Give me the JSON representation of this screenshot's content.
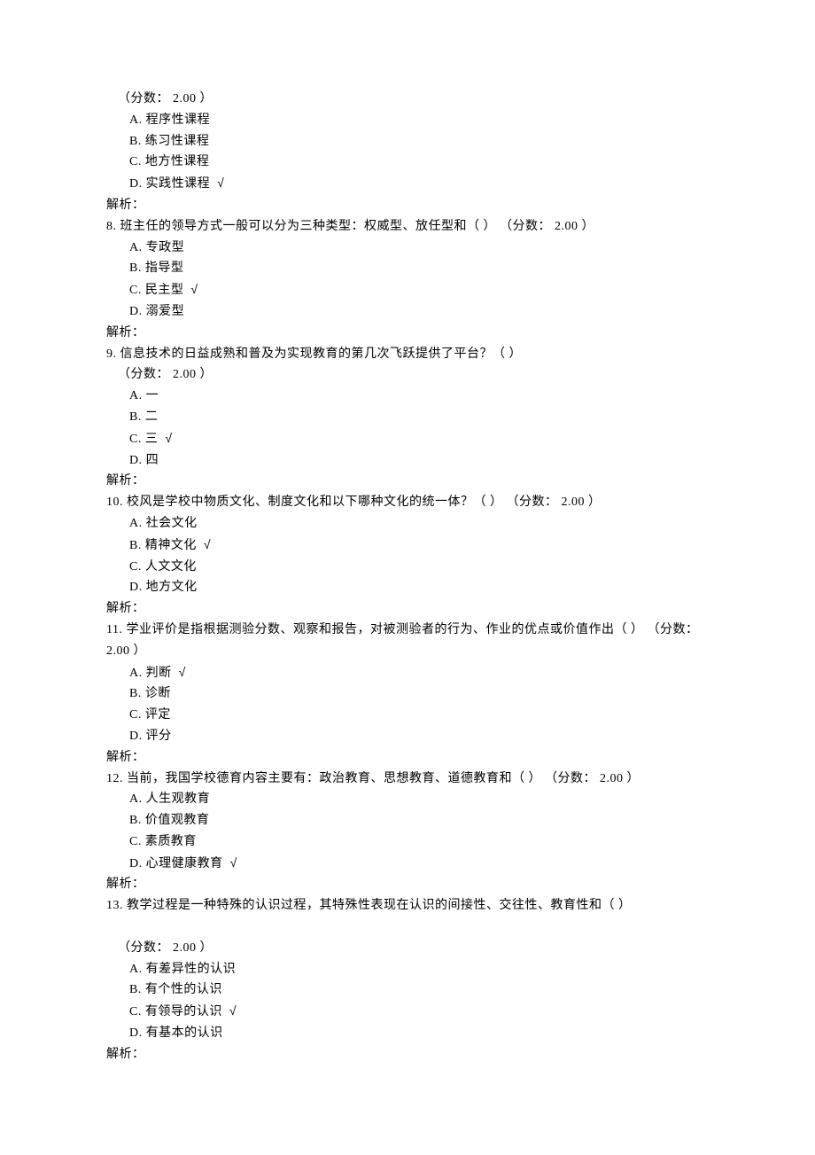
{
  "q7": {
    "score_label": "（分数： 2.00 ）",
    "options": {
      "a": "A. 程序性课程",
      "b": "B. 练习性课程",
      "c": "C. 地方性课程",
      "d_text": "D. 实践性课程",
      "d_check": "√"
    },
    "analysis": "解析："
  },
  "q8": {
    "stem": "8. 班主任的领导方式一般可以分为三种类型：权威型、放任型和（ ） （分数： 2.00 ）",
    "options": {
      "a": "A. 专政型",
      "b": "B. 指导型",
      "c_text": "C. 民主型",
      "c_check": "√",
      "d": "D. 溺爱型"
    },
    "analysis": "解析："
  },
  "q9": {
    "stem": "9. 信息技术的日益成熟和普及为实现教育的第几次飞跃提供了平台？（      ）",
    "score_label": "（分数： 2.00 ）",
    "options": {
      "a": "A. 一",
      "b": "B. 二",
      "c_text": "C. 三",
      "c_check": "√",
      "d": "D. 四"
    },
    "analysis": "解析："
  },
  "q10": {
    "stem": "10. 校风是学校中物质文化、制度文化和以下哪种文化的统一体？（ ） （分数： 2.00 ）",
    "options": {
      "a": "A. 社会文化",
      "b_text": "B. 精神文化",
      "b_check": "√",
      "c": "C. 人文文化",
      "d": "D. 地方文化"
    },
    "analysis": "解析："
  },
  "q11": {
    "stem": "11. 学业评价是指根据测验分数、观察和报告，对被测验者的行为、作业的优点或价值作出（ ） （分数：",
    "score_label": "2.00 ）",
    "options": {
      "a_text": "A. 判断",
      "a_check": "√",
      "b": "B. 诊断",
      "c": "C. 评定",
      "d": "D. 评分"
    },
    "analysis": "解析："
  },
  "q12": {
    "stem": "12. 当前，我国学校德育内容主要有：政治教育、思想教育、道德教育和（ ） （分数： 2.00 ）",
    "options": {
      "a": "A. 人生观教育",
      "b": "B. 价值观教育",
      "c": "C. 素质教育",
      "d_text": "D. 心理健康教育",
      "d_check": "√"
    },
    "analysis": "解析："
  },
  "q13": {
    "stem": "13. 教学过程是一种特殊的认识过程，其特殊性表现在认识的间接性、交往性、教育性和（      ）",
    "score_label": "（分数： 2.00 ）",
    "options": {
      "a": "A. 有差异性的认识",
      "b": "B. 有个性的认识",
      "c_text": "C. 有领导的认识",
      "c_check": "√",
      "d": "D. 有基本的认识"
    },
    "analysis": "解析："
  }
}
